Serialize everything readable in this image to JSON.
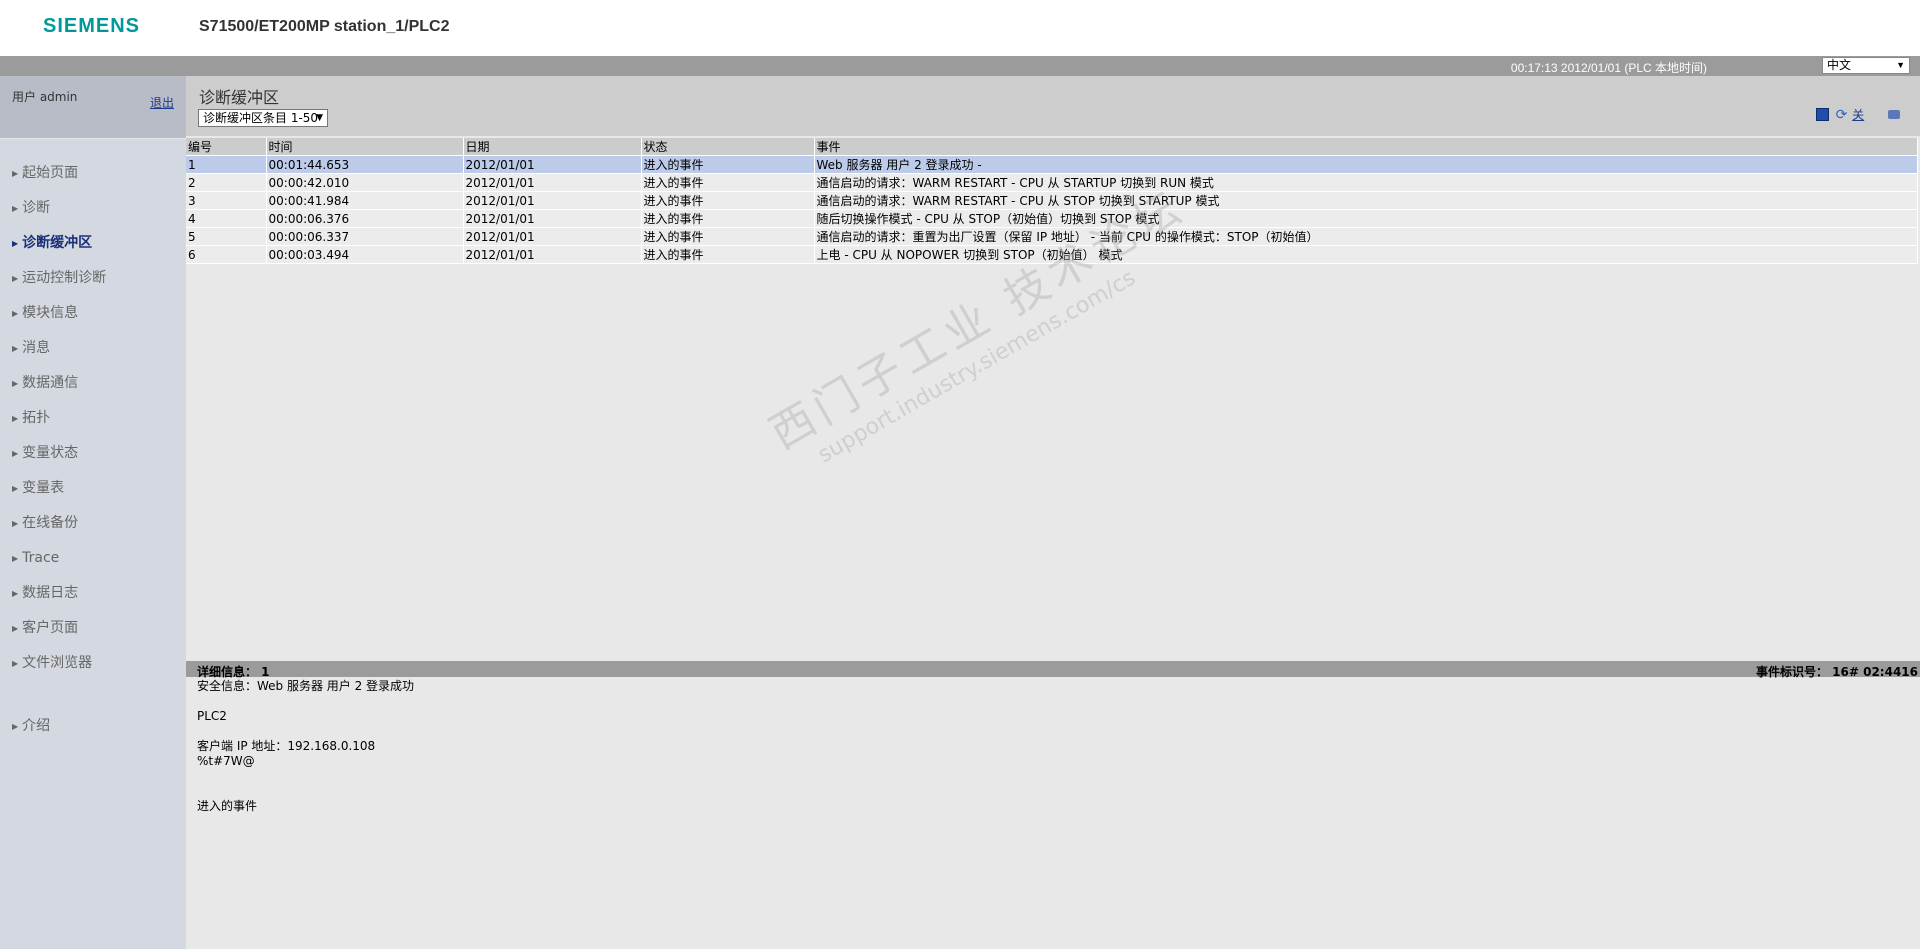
{
  "header": {
    "logo": "SIEMENS",
    "station": "S71500/ET200MP station_1/PLC2"
  },
  "statusbar": {
    "time": "00:17:13   2012/01/01   (PLC 本地时间)",
    "language": "中文"
  },
  "sidebar": {
    "user": "用户 admin",
    "logout": "退出",
    "items": [
      {
        "label": "起始页面"
      },
      {
        "label": "诊断"
      },
      {
        "label": "诊断缓冲区"
      },
      {
        "label": "运动控制诊断"
      },
      {
        "label": "模块信息"
      },
      {
        "label": "消息"
      },
      {
        "label": "数据通信"
      },
      {
        "label": "拓扑"
      },
      {
        "label": "变量状态"
      },
      {
        "label": "变量表"
      },
      {
        "label": "在线备份"
      },
      {
        "label": "Trace"
      },
      {
        "label": "数据日志"
      },
      {
        "label": "客户页面"
      },
      {
        "label": "文件浏览器"
      }
    ],
    "intro": "介绍"
  },
  "main": {
    "title": "诊断缓冲区",
    "entry_select": "诊断缓冲区条目 1-50",
    "tool_off": "关",
    "table": {
      "headers": [
        "编号",
        "时间",
        "日期",
        "状态",
        "事件"
      ],
      "rows": [
        [
          "1",
          "00:01:44.653",
          "2012/01/01",
          "进入的事件",
          " Web 服务器 用户 2 登录成功 -"
        ],
        [
          "2",
          "00:00:42.010",
          "2012/01/01",
          "进入的事件",
          " 通信启动的请求：WARM RESTART - CPU 从 STARTUP 切换到 RUN 模式"
        ],
        [
          "3",
          "00:00:41.984",
          "2012/01/01",
          "进入的事件",
          " 通信启动的请求：WARM RESTART - CPU 从 STOP 切换到 STARTUP 模式"
        ],
        [
          "4",
          "00:00:06.376",
          "2012/01/01",
          "进入的事件",
          " 随后切换操作模式 - CPU 从 STOP（初始值）切换到 STOP 模式"
        ],
        [
          "5",
          "00:00:06.337",
          "2012/01/01",
          "进入的事件",
          " 通信启动的请求：重置为出厂设置（保留 IP 地址） - 当前 CPU 的操作模式：STOP（初始值）"
        ],
        [
          "6",
          "00:00:03.494",
          "2012/01/01",
          "进入的事件",
          " 上电 - CPU 从 NOPOWER 切换到 STOP（初始值） 模式"
        ]
      ]
    },
    "watermark": {
      "line1": "西门子工业 技术论坛",
      "line2": "support.industry.siemens.com/cs"
    },
    "detail": {
      "header_left": "详细信息：  1",
      "header_right": "事件标识号：  16# 02:4416",
      "lines": [
        "安全信息：Web 服务器 用户 2 登录成功",
        "",
        " PLC2",
        "",
        "客户端 IP 地址：192.168.0.108",
        "%t#7W@",
        "",
        "",
        "进入的事件"
      ]
    }
  }
}
